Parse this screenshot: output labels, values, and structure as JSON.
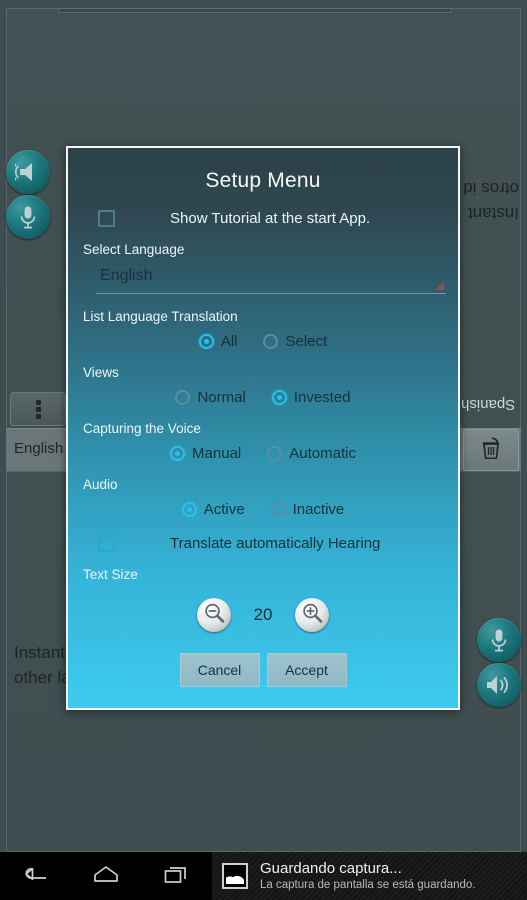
{
  "background_app": {
    "rotated_text_line1": "Instant",
    "rotated_text_line2": "otros id",
    "rotated_language_label": "Spanish",
    "language_label": "English",
    "bottom_text_line1": "Instant",
    "bottom_text_line2": "other la",
    "menu_icon": "overflow-menu-icon",
    "trash_icon": "trash-icon",
    "left_speaker_icon": "speaker-icon",
    "left_mic_icon": "microphone-icon",
    "right_mic_icon": "microphone-icon",
    "right_speaker_icon": "speaker-icon"
  },
  "dialog": {
    "title": "Setup Menu",
    "tutorial": {
      "label": "Show Tutorial at the start App.",
      "checked": false
    },
    "select_language": {
      "label": "Select Language",
      "value": "English",
      "arrow_icon": "spinner-arrow-icon"
    },
    "list_language_translation": {
      "label": "List Language Translation",
      "options": [
        "All",
        "Select"
      ],
      "selected": "All"
    },
    "views": {
      "label": "Views",
      "options": [
        "Normal",
        "Invested"
      ],
      "selected": "Invested"
    },
    "capturing_the_voice": {
      "label": "Capturing the Voice",
      "options": [
        "Manual",
        "Automatic"
      ],
      "selected": "Manual"
    },
    "audio": {
      "label": "Audio",
      "options": [
        "Active",
        "Inactive"
      ],
      "selected": "Active"
    },
    "translate_hearing": {
      "label": "Translate automatically Hearing",
      "checked": true
    },
    "text_size": {
      "label": "Text Size",
      "value": "20",
      "decrease_icon": "zoom-out-icon",
      "increase_icon": "zoom-in-icon"
    },
    "buttons": {
      "cancel": "Cancel",
      "accept": "Accept"
    }
  },
  "navbar": {
    "back_icon": "back-icon",
    "home_icon": "home-icon",
    "recents_icon": "recent-apps-icon",
    "notification": {
      "icon": "screenshot-image-icon",
      "title": "Guardando captura...",
      "subtitle": "La captura de pantalla se está guardando."
    }
  },
  "colors": {
    "accent": "#27c1ef",
    "dialog_top": "#2c4147",
    "dialog_bottom": "#3ecbef",
    "app_background": "#3f4d50",
    "teal_button": "#1d787e"
  }
}
